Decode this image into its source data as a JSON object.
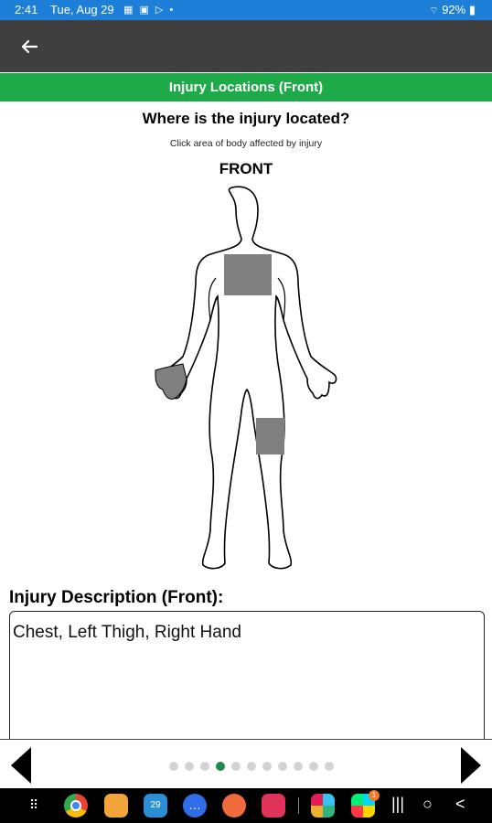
{
  "status_bar": {
    "time": "2:41",
    "date": "Tue, Aug 29",
    "battery": "92%"
  },
  "app_bar": {
    "back_icon": "arrow-left"
  },
  "section": {
    "title": "Injury Locations (Front)"
  },
  "prompt": {
    "question": "Where is the injury located?",
    "hint": "Click area of body affected by injury",
    "side_label": "FRONT"
  },
  "body_map": {
    "selected_regions": [
      "Chest",
      "Left Thigh",
      "Right Hand"
    ],
    "highlight_color": "#808080"
  },
  "description": {
    "label": "Injury Description (Front):",
    "value": "Chest, Left Thigh, Right Hand"
  },
  "pager": {
    "total": 11,
    "active_index": 3
  },
  "nav_bar": {
    "apps": [
      "chrome",
      "files",
      "calendar",
      "messages",
      "contacts",
      "camera",
      "slack",
      "play-store"
    ],
    "play_store_badge": "1"
  },
  "colors": {
    "status_bar": "#1e7fd8",
    "app_bar": "#3f3f3f",
    "section_header": "#1faa4a",
    "active_dot": "#1f8a4c"
  }
}
